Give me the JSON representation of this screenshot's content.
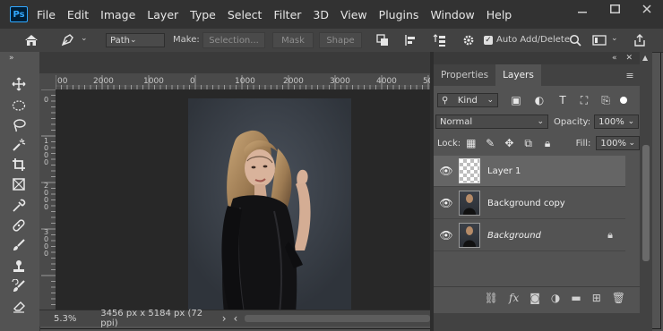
{
  "app": {
    "logo": "Ps"
  },
  "menu": [
    "File",
    "Edit",
    "Image",
    "Layer",
    "Type",
    "Select",
    "Filter",
    "3D",
    "View",
    "Plugins",
    "Window",
    "Help"
  ],
  "window_controls": {
    "minimize": "minimize-icon",
    "maximize": "maximize-icon",
    "close": "close-icon"
  },
  "options_bar": {
    "mode": "Path",
    "make_label": "Make:",
    "selection_btn": "Selection...",
    "mask_btn": "Mask",
    "shape_btn": "Shape",
    "auto_add_delete": "Auto Add/Delete",
    "auto_add_checked": true
  },
  "ruler": {
    "h_labels": [
      "00",
      "2000",
      "1000",
      "0",
      "1000",
      "2000",
      "3000",
      "4000",
      "50"
    ],
    "v_labels": [
      "0",
      "1 0 0 0",
      "2 0 0 0",
      "3 0 0 0"
    ]
  },
  "status": {
    "zoom": "5.3%",
    "doc_info": "3456 px x 5184 px (72 ppi)",
    "arrow": "›"
  },
  "panel": {
    "tabs": [
      "Properties",
      "Layers"
    ],
    "active_tab": "Layers",
    "filter_kind": "Kind",
    "blend_mode": "Normal",
    "opacity_label": "Opacity:",
    "opacity_value": "100%",
    "lock_label": "Lock:",
    "fill_label": "Fill:",
    "fill_value": "100%",
    "layers": [
      {
        "name": "Layer 1",
        "selected": true,
        "thumb": "transparent",
        "italic": false,
        "locked": false
      },
      {
        "name": "Background copy",
        "selected": false,
        "thumb": "photo",
        "italic": false,
        "locked": false
      },
      {
        "name": "Background",
        "selected": false,
        "thumb": "photo",
        "italic": true,
        "locked": true
      }
    ]
  },
  "colors": {
    "accent": "#31a8ff",
    "chrome": "#535353",
    "menubar": "#323232",
    "canvas": "#282828"
  }
}
